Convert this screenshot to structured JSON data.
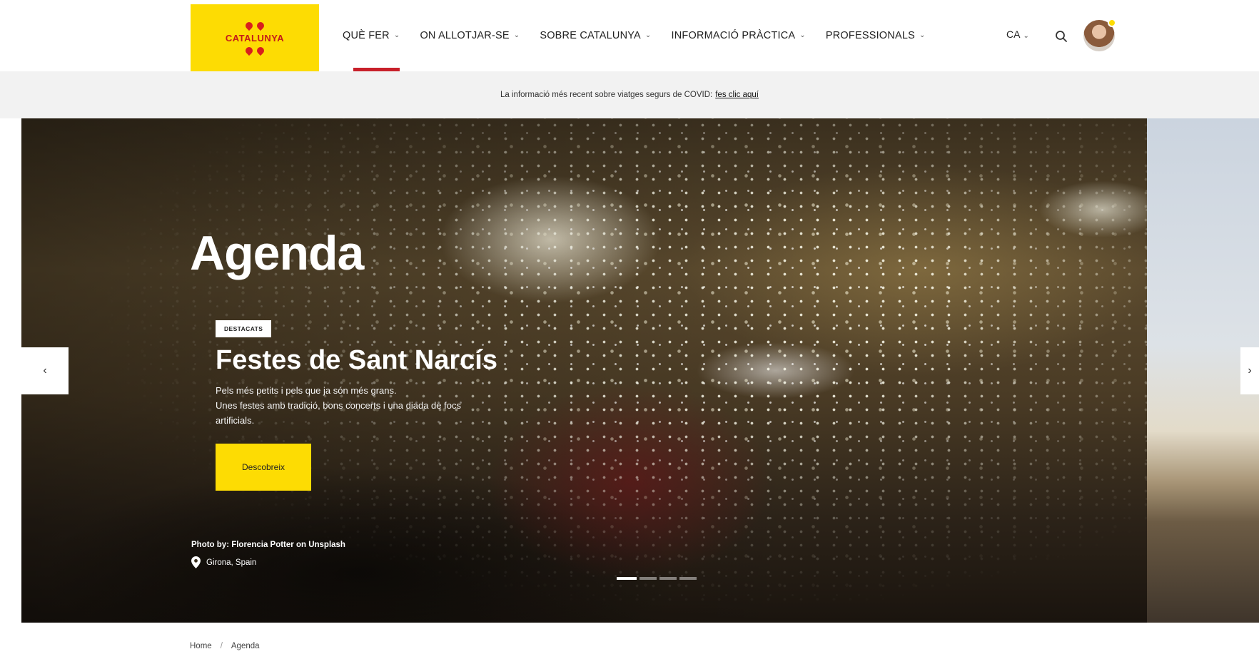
{
  "header": {
    "logo_text": "CATALUNYA",
    "nav": [
      {
        "label": "QUÈ FER",
        "active": true
      },
      {
        "label": "ON ALLOTJAR-SE",
        "active": false
      },
      {
        "label": "SOBRE CATALUNYA",
        "active": false
      },
      {
        "label": "INFORMACIÓ PRÀCTICA",
        "active": false
      },
      {
        "label": "PROFESSIONALS",
        "active": false
      }
    ],
    "language": "CA",
    "chevron": "⌄"
  },
  "covid_bar": {
    "text": "La informació més recent sobre viatges segurs de COVID:",
    "link": "fes clic aquí"
  },
  "hero": {
    "title": "Agenda",
    "badge": "DESTACATS",
    "event_title": "Festes de Sant Narcís",
    "description": [
      "Pels més petits i pels que ja són més grans.",
      "Unes festes amb tradició, bons concerts i una diada de focs",
      "artificials."
    ],
    "cta": "Descobreix",
    "photo_credit": "Photo by: Florencia Potter on Unsplash",
    "location": "Girona, Spain",
    "slides_total": 4,
    "slide_active": 1,
    "prev_arrow": "‹",
    "next_arrow": "›"
  },
  "breadcrumb": {
    "home": "Home",
    "separator": "/",
    "current": "Agenda"
  },
  "colors": {
    "brand_yellow": "#fddc03",
    "accent_red": "#c8202a"
  },
  "icons": {
    "search": "search-icon",
    "location": "location-pin-icon",
    "chevron": "chevron-down-icon",
    "prev": "chevron-left-icon",
    "next": "chevron-right-icon"
  }
}
